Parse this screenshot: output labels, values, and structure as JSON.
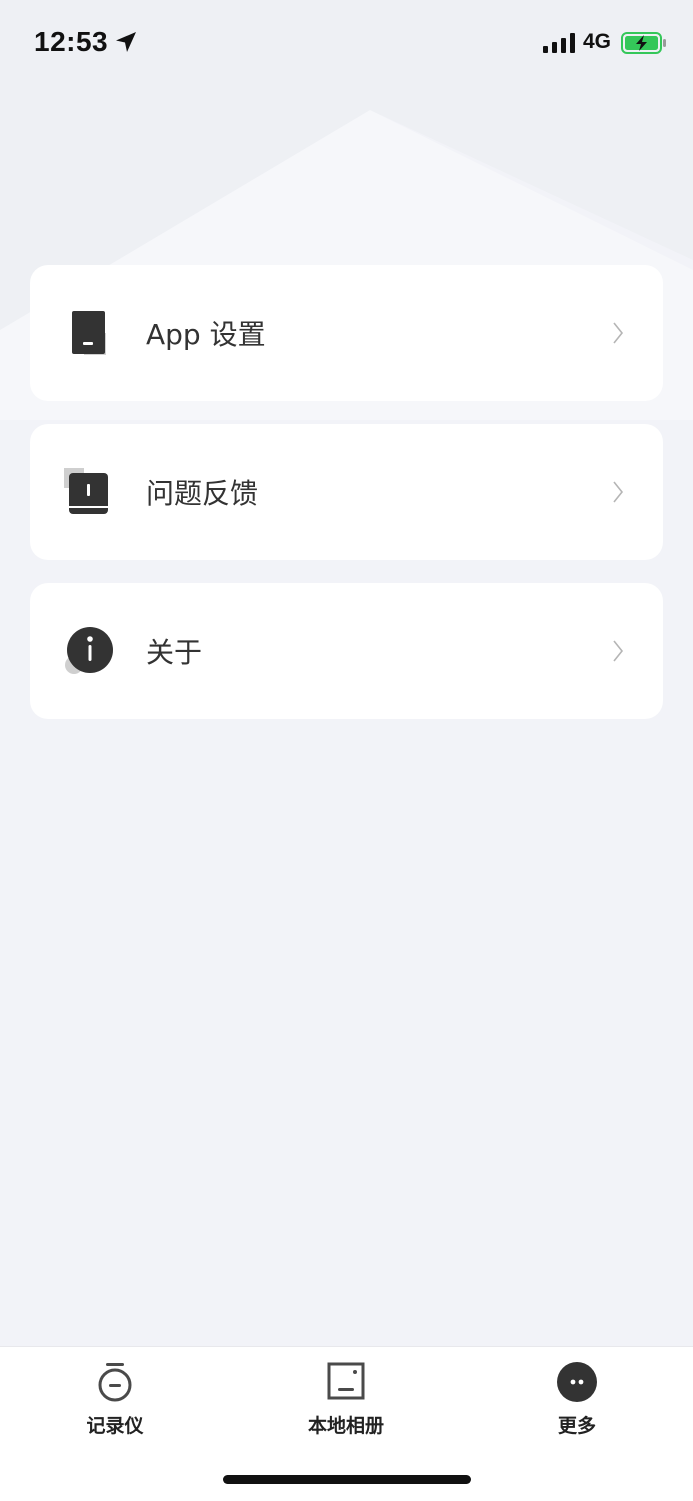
{
  "status_bar": {
    "time": "12:53",
    "network": "4G",
    "icons": [
      "location-arrow-icon",
      "signal-bars-icon",
      "battery-charging-icon"
    ]
  },
  "menu": {
    "items": [
      {
        "label": "App 设置",
        "icon": "app-settings-icon"
      },
      {
        "label": "问题反馈",
        "icon": "feedback-book-icon"
      },
      {
        "label": "关于",
        "icon": "info-icon"
      }
    ]
  },
  "tab_bar": {
    "tabs": [
      {
        "label": "记录仪",
        "icon": "recorder-icon"
      },
      {
        "label": "本地相册",
        "icon": "album-icon"
      },
      {
        "label": "更多",
        "icon": "more-icon",
        "active": true
      }
    ]
  },
  "colors": {
    "background": "#f2f3f8",
    "card": "#ffffff",
    "icon_dark": "#333333",
    "icon_shadow": "#cfcfcf",
    "battery_green": "#34c759"
  }
}
